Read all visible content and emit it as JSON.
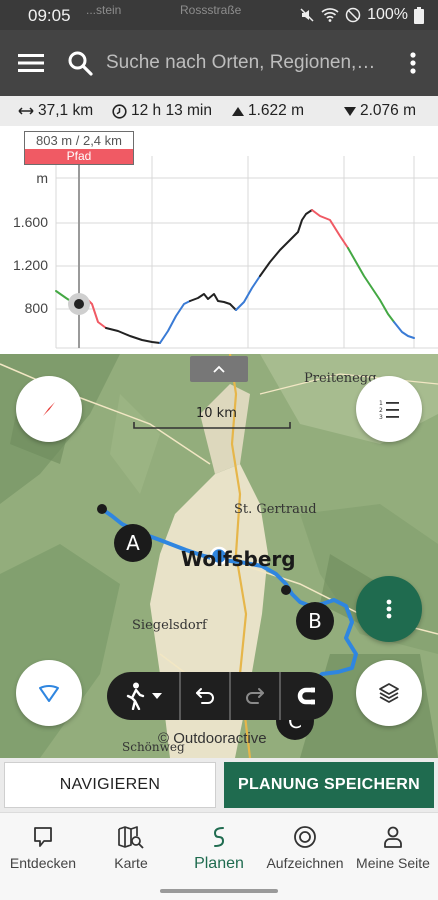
{
  "status_bar": {
    "time": "09:05",
    "battery": "100%",
    "ghost_left": "...stein",
    "ghost_mid": "Rossstraße"
  },
  "app_bar": {
    "search_placeholder": "Suche nach Orten, Regionen,…",
    "menu_icon": "hamburger-icon",
    "more_icon": "vertical-dots-icon"
  },
  "stats": {
    "distance": "37,1 km",
    "duration": "12 h 13 min",
    "ascent": "1.622 m",
    "descent": "2.076 m"
  },
  "profile": {
    "cursor_value": "803 m / 2,4 km",
    "cursor_type": "Pfad",
    "y_unit": "m",
    "y_ticks": [
      "1.600",
      "1.200",
      "800"
    ],
    "legend_colors": {
      "path": "#f05a64",
      "road": "#3a7bd5",
      "trail": "#44a844",
      "default": "#222222"
    }
  },
  "map": {
    "scale_label": "10 km",
    "places": {
      "preitenegg": "Preitenegg",
      "st_gertraud": "St. Gertraud",
      "wolfsberg": "Wolfsberg",
      "siegelsdorf": "Siegelsdorf",
      "schoenweg": "Schönweg"
    },
    "waypoints": [
      "A",
      "B",
      "C"
    ],
    "copyright": "© Outdooractive",
    "route_color": "#2f86e0"
  },
  "actions": {
    "navigate": "NAVIGIEREN",
    "save": "PLANUNG SPEICHERN"
  },
  "bottom_nav": [
    {
      "label": "Entdecken",
      "icon": "chat-bubble-icon"
    },
    {
      "label": "Karte",
      "icon": "map-search-icon"
    },
    {
      "label": "Planen",
      "icon": "route-icon"
    },
    {
      "label": "Aufzeichnen",
      "icon": "record-icon"
    },
    {
      "label": "Meine Seite",
      "icon": "person-icon"
    }
  ],
  "colors": {
    "primary": "#1f6b4f",
    "app_bar": "#444444"
  }
}
